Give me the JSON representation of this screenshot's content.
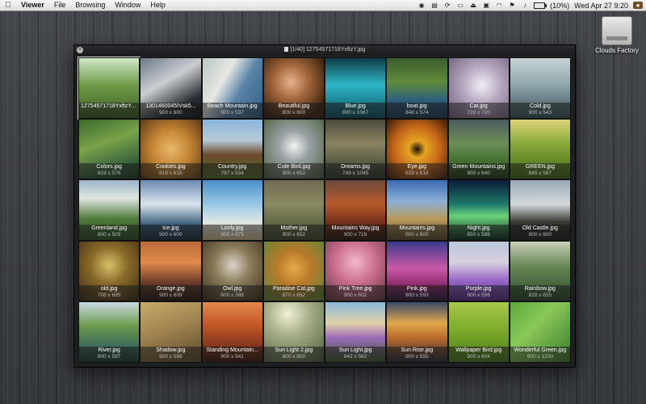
{
  "menubar": {
    "apple": "",
    "app_name": "Viewer",
    "menus": [
      "File",
      "Browsing",
      "Window",
      "Help"
    ],
    "status": {
      "battery": "(10%)",
      "datetime": "Wed Apr 27  9:20"
    }
  },
  "desktop": {
    "drive_label": "Clouds Factory"
  },
  "window": {
    "title": "[1/40] 12754571718YxftzY.jpg",
    "close": "×"
  },
  "thumbnails": [
    {
      "name": "12754571718YxftzY.jpg",
      "size": "",
      "bg": "linear-gradient(180deg,#cfe8c8 0%,#6f9b48 45%,#3e5f25 100%)",
      "selected": true
    },
    {
      "name": "1301460045IVsk5...",
      "size": "900 x 600",
      "bg": "linear-gradient(150deg,#6e7a86 0%,#c9ced2 40%,#2c3034 75%,#111 100%)"
    },
    {
      "name": "Beach Mountain.jpg",
      "size": "900 x 537",
      "bg": "linear-gradient(120deg,#b9c7c4 0%,#e6e8e2 35%,#5a84a8 60%,#2f5e82 100%)"
    },
    {
      "name": "Beautiful.jpg",
      "size": "800 x 800",
      "bg": "radial-gradient(circle at 45% 40%,#e8b48f 0%,#a5683c 35%,#3b2410 80%)"
    },
    {
      "name": "Blue.jpg",
      "size": "800 x 1067",
      "bg": "linear-gradient(180deg,#0e3e47 0%,#2fb7c7 45%,#0b4f5c 100%)"
    },
    {
      "name": "boat.jpg",
      "size": "848 x 574",
      "bg": "linear-gradient(180deg,#3b5d2f 0%,#5f8a3a 40%,#2d5f7c 70%,#1d3b52 100%)"
    },
    {
      "name": "Cat.jpg",
      "size": "720 x 720",
      "bg": "radial-gradient(circle at 55% 45%,#f0eef2 0%,#b8a9c2 40%,#6c5c78 100%)"
    },
    {
      "name": "Cold.jpg",
      "size": "900 x 543",
      "bg": "linear-gradient(180deg,#c8d4d6 0%,#8ea6ab 45%,#3a5258 100%)"
    },
    {
      "name": "Colors.jpg",
      "size": "819 x 576",
      "bg": "linear-gradient(160deg,#3a6a2c 0%,#7aa24a 40%,#2f5a3a 80%,#1d3a22 100%)"
    },
    {
      "name": "Cookies.jpg",
      "size": "819 x 615",
      "bg": "radial-gradient(circle at 50% 50%,#e8b86a 0%,#c48634 45%,#5e3a16 100%)"
    },
    {
      "name": "Country.jpg",
      "size": "797 x 534",
      "bg": "linear-gradient(180deg,#8cb6de 0%,#b5c9d8 35%,#6b4a2c 60%,#4f6b2c 100%)"
    },
    {
      "name": "Cute Bird.jpg",
      "size": "900 x 652",
      "bg": "radial-gradient(circle at 50% 45%,#f2f2f2 0%,#9aa1a4 35%,#4a5f3a 100%)"
    },
    {
      "name": "Dreams.jpg",
      "size": "749 x 1045",
      "bg": "linear-gradient(180deg,#4a4a3a 0%,#8a8462 40%,#2e3a2a 100%)"
    },
    {
      "name": "Eye.jpg",
      "size": "629 x 618",
      "bg": "radial-gradient(circle at 50% 50%,#1a0f05 0%,#e7a422 20%,#c4661a 55%,#3b1a06 100%)"
    },
    {
      "name": "Green Mountains.jpg",
      "size": "900 x 640",
      "bg": "linear-gradient(180deg,#4a5a5c 0%,#6d8e5a 40%,#3d6a2a 75%,#223d17 100%)"
    },
    {
      "name": "GREEN.jpg",
      "size": "845 x 587",
      "bg": "linear-gradient(180deg,#ded67a 0%,#8aa93a 40%,#3f6a1c 100%)"
    },
    {
      "name": "Greenland.jpg",
      "size": "800 x 509",
      "bg": "linear-gradient(180deg,#9cb6c8 0%,#dfe6e2 30%,#4f7a3a 65%,#2d4e24 100%)"
    },
    {
      "name": "Ice.jpg",
      "size": "900 x 600",
      "bg": "linear-gradient(180deg,#6a8bb0 0%,#d8e4ec 40%,#3a5a78 75%,#1b2c3d 100%)"
    },
    {
      "name": "Lonly.jpg",
      "size": "900 x 675",
      "bg": "linear-gradient(180deg,#4a8ec8 0%,#9ac8e6 40%,#dfe6e4 70%,#c9b48c 100%)"
    },
    {
      "name": "Mother.jpg",
      "size": "900 x 652",
      "bg": "linear-gradient(180deg,#6f6a52 0%,#8a8a62 40%,#3f4a2e 100%)"
    },
    {
      "name": "Mountains Way.jpg",
      "size": "900 x 719",
      "bg": "linear-gradient(180deg,#6a4a3a 0%,#b85a2a 40%,#6a2a18 75%,#2a1a12 100%)"
    },
    {
      "name": "Mountains.jpg",
      "size": "900 x 600",
      "bg": "linear-gradient(180deg,#3a6ab0 0%,#8ab0d8 35%,#b89a5a 65%,#5a4a2a 100%)"
    },
    {
      "name": "Night.jpg",
      "size": "850 x 588",
      "bg": "linear-gradient(180deg,#0a1a3a 0%,#1e7a6a 40%,#6ad07a 60%,#0a2a1a 100%)"
    },
    {
      "name": "Old Castle.jpg",
      "size": "900 x 600",
      "bg": "linear-gradient(180deg,#9aa9b6 0%,#d2d8da 40%,#3a3a32 70%,#1e1e1a 100%)"
    },
    {
      "name": "old.jpg",
      "size": "708 x 695",
      "bg": "radial-gradient(circle at 50% 40%,#d8c06a 0%,#8a6a2a 40%,#3a2a12 100%)"
    },
    {
      "name": "Orange.jpg",
      "size": "900 x 609",
      "bg": "linear-gradient(180deg,#b86a3a 0%,#e08a4a 35%,#6a3a2a 70%,#2a1a12 100%)"
    },
    {
      "name": "Owl.jpg",
      "size": "600 x 398",
      "bg": "radial-gradient(circle at 50% 40%,#d9d4c8 0%,#8a7a5a 40%,#3a2e1e 100%)"
    },
    {
      "name": "Paradise Cat.jpg",
      "size": "870 x 652",
      "bg": "radial-gradient(circle at 50% 45%,#e8a84a 0%,#b8782a 40%,#5a8a3a 100%)"
    },
    {
      "name": "Pink Tree.jpg",
      "size": "900 x 602",
      "bg": "radial-gradient(circle at 50% 35%,#f2b8c8 0%,#c86a8a 45%,#5a3a3a 100%)"
    },
    {
      "name": "Pink.jpg",
      "size": "900 x 593",
      "bg": "linear-gradient(180deg,#3a3a8a 0%,#c85aa8 45%,#8a2a6a 75%,#2a1a3a 100%)"
    },
    {
      "name": "Purple.jpg",
      "size": "900 x 598",
      "bg": "linear-gradient(180deg,#b8c8d8 0%,#d8d0e0 35%,#9a6ac8 65%,#5a2a8a 100%)"
    },
    {
      "name": "Rainbow.jpg",
      "size": "828 x 655",
      "bg": "linear-gradient(180deg,#c8d0b8 0%,#6a8a5a 40%,#2a4a2a 100%)"
    },
    {
      "name": "River.jpg",
      "size": "900 x 597",
      "bg": "linear-gradient(180deg,#c8d8e0 0%,#6a9a4a 40%,#3a6a5a 75%,#1e3a2e 100%)"
    },
    {
      "name": "Shadow.jpg",
      "size": "900 x 598",
      "bg": "linear-gradient(160deg,#c8aa6a 0%,#a08450 45%,#5a4a2a 100%)"
    },
    {
      "name": "Standing Mountain...",
      "size": "900 x 541",
      "bg": "linear-gradient(180deg,#e08a4a 0%,#c85a2a 35%,#8a3a1e 70%,#3a1a0e 100%)"
    },
    {
      "name": "Sun Light 2.jpg",
      "size": "800 x 600",
      "bg": "radial-gradient(circle at 40% 20%,#f2f0d8 0%,#a8b08a 35%,#4a5a3a 100%)"
    },
    {
      "name": "Sun Light.jpg",
      "size": "842 x 562",
      "bg": "linear-gradient(180deg,#8ab8d8 0%,#dfd0a8 35%,#9a6ab8 60%,#3a5a2a 100%)"
    },
    {
      "name": "Sun Rise.jpg",
      "size": "900 x 555",
      "bg": "linear-gradient(180deg,#3a4a6a 0%,#e0a84a 35%,#b86a2a 60%,#2a2a3a 100%)"
    },
    {
      "name": "Wallpaper Bird.jpg",
      "size": "900 x 604",
      "bg": "linear-gradient(180deg,#a8c84a 0%,#7aa82a 50%,#4a7a1a 100%)"
    },
    {
      "name": "Wonderful Green.jpg",
      "size": "900 x 1200",
      "bg": "linear-gradient(135deg,#5aa83a 0%,#8ac85a 40%,#3a7a2a 100%)"
    }
  ]
}
